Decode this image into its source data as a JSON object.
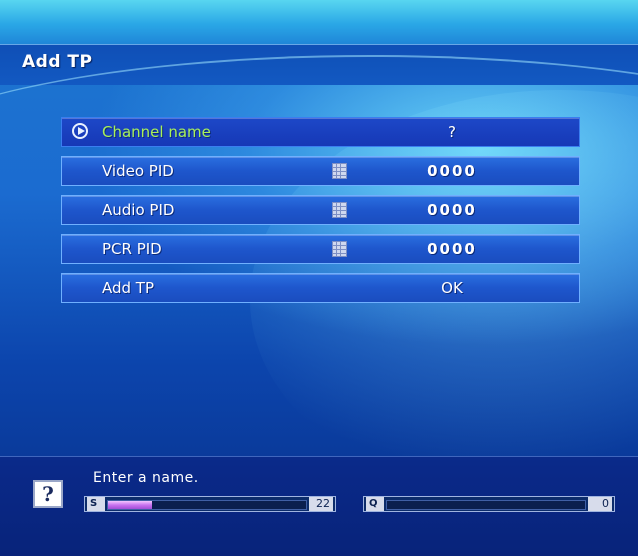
{
  "window": {
    "title": "Add TP"
  },
  "menu": {
    "items": [
      {
        "label": "Channel name",
        "value": "?"
      },
      {
        "label": "Video PID",
        "value": "0000"
      },
      {
        "label": "Audio PID",
        "value": "0000"
      },
      {
        "label": "PCR PID",
        "value": "0000"
      },
      {
        "label": "Add TP",
        "value": "OK"
      }
    ]
  },
  "footer": {
    "hint": "Enter a name.",
    "help_icon": "?",
    "signal": {
      "tag": "S",
      "value": "22",
      "level_percent": 22
    },
    "quality": {
      "tag": "Q",
      "value": "0",
      "level_percent": 0
    }
  },
  "colors": {
    "selected_label": "#a9f05a",
    "meter_fill": "#c873f0"
  },
  "icons": [
    "play-circle-icon",
    "keypad-icon",
    "help-icon"
  ]
}
